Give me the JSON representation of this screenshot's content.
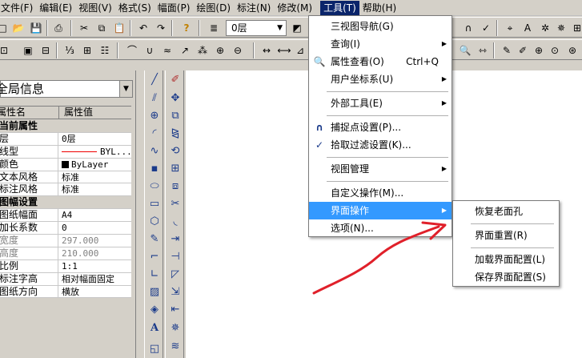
{
  "menubar": {
    "items": [
      {
        "label": "文件(F)"
      },
      {
        "label": "编辑(E)"
      },
      {
        "label": "视图(V)"
      },
      {
        "label": "格式(S)"
      },
      {
        "label": "幅面(P)"
      },
      {
        "label": "绘图(D)"
      },
      {
        "label": "标注(N)"
      },
      {
        "label": "修改(M)"
      },
      {
        "label": "工具(T)"
      },
      {
        "label": "帮助(H)"
      }
    ]
  },
  "toolbar": {
    "layer_value": "0层"
  },
  "property_panel": {
    "title": "全局信息",
    "col_name": "属性名",
    "col_value": "属性值",
    "rows": [
      {
        "k": "当前属性",
        "v": "",
        "group": true
      },
      {
        "k": "层",
        "v": "0层"
      },
      {
        "k": "线型",
        "v": "BYL..."
      },
      {
        "k": "颜色",
        "v": "ByLayer"
      },
      {
        "k": "文本风格",
        "v": "标准"
      },
      {
        "k": "标注风格",
        "v": "标准"
      },
      {
        "k": "图幅设置",
        "v": "",
        "group": true
      },
      {
        "k": "图纸幅面",
        "v": "A4"
      },
      {
        "k": "加长系数",
        "v": "0"
      },
      {
        "k": "宽度",
        "v": "297.000",
        "dim": true
      },
      {
        "k": "高度",
        "v": "210.000",
        "dim": true
      },
      {
        "k": "比例",
        "v": "1:1"
      },
      {
        "k": "标注字高",
        "v": "相对幅面固定"
      },
      {
        "k": "图纸方向",
        "v": "横放"
      }
    ]
  },
  "tools_menu": {
    "items": [
      {
        "label": "三视图导航(G)"
      },
      {
        "label": "查询(I)"
      },
      {
        "label": "属性查看(O)",
        "shortcut": "Ctrl+Q"
      },
      {
        "label": "用户坐标系(U)"
      },
      {
        "label": "外部工具(E)"
      },
      {
        "label": "捕捉点设置(P)..."
      },
      {
        "label": "拾取过滤设置(K)..."
      },
      {
        "label": "视图管理"
      },
      {
        "label": "自定义操作(M)..."
      },
      {
        "label": "界面操作"
      },
      {
        "label": "选项(N)..."
      }
    ]
  },
  "ui_submenu": {
    "items": [
      {
        "label": "恢复老面孔"
      },
      {
        "label": "界面重置(R)"
      },
      {
        "label": "加载界面配置(L)"
      },
      {
        "label": "保存界面配置(S)"
      }
    ]
  },
  "colors": {
    "menu_highlight": "#3399ff",
    "active_menu": "#0a246a",
    "annotation_arrow": "#e0202a"
  }
}
